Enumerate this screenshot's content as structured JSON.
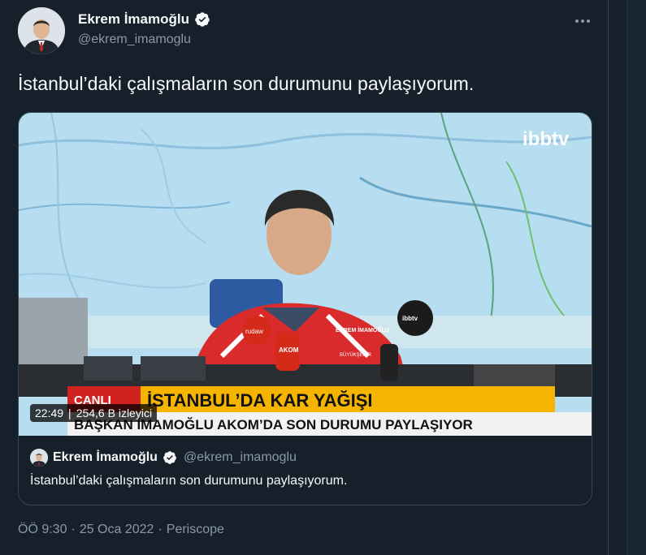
{
  "author": {
    "name": "Ekrem İmamoğlu",
    "handle": "@ekrem_imamoglu",
    "verified": true
  },
  "tweet": {
    "text": "İstanbul’daki çalışmaların son durumunu paylaşıyorum."
  },
  "video": {
    "duration": "22:49",
    "viewers": "254,6 B izleyici",
    "channel_logo": "ibbtv",
    "banner_tag": "CANLI",
    "banner_headline": "İSTANBUL’DA KAR YAĞIŞI",
    "banner_subline": "BAŞKAN İMAMOĞLU AKOM’DA SON DURUMU PAYLAŞIYOR",
    "jacket_text_1": "EKREM İMAMOĞLU",
    "jacket_text_2": "BÜYÜKŞEHİR",
    "mic_labels": [
      "rudaw",
      "AKOM",
      "ibbtv"
    ]
  },
  "quote": {
    "name": "Ekrem İmamoğlu",
    "handle": "@ekrem_imamoglu",
    "text": "İstanbul’daki çalışmaların son durumunu paylaşıyorum."
  },
  "meta": {
    "time": "ÖÖ 9:30",
    "dot": "·",
    "date": "25 Oca 2022",
    "dot2": "·",
    "source": "Periscope"
  },
  "colors": {
    "background": "#15202b",
    "border": "#38444d",
    "secondary_text": "#8b98a5",
    "verified": "#1d9bf0",
    "banner_yellow": "#f5b400",
    "banner_red": "#d0231f"
  },
  "icons": [
    "verified-badge-icon",
    "more-icon"
  ]
}
